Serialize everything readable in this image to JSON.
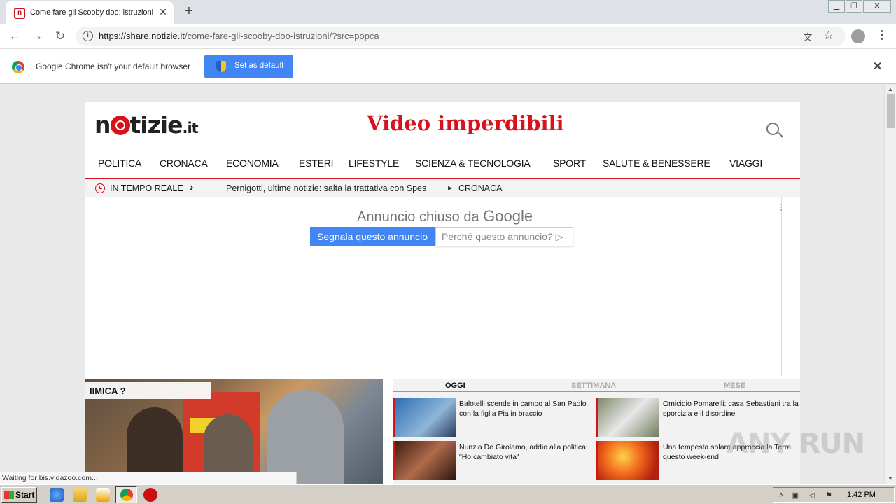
{
  "browser": {
    "tab_title": "Come fare gli Scooby doo: istruzioni",
    "favicon_letter": "n",
    "url_host": "https://share.notizie.it",
    "url_path": "/come-fare-gli-scooby-doo-istruzioni/?src=popca",
    "window_controls": [
      "minimize",
      "restore",
      "close"
    ]
  },
  "infobar": {
    "message": "Google Chrome isn't your default browser",
    "button": "Set as default"
  },
  "site": {
    "logo_text": "notizie",
    "logo_tld": ".it",
    "headline": "Video imperdibili",
    "nav": [
      "POLITICA",
      "CRONACA",
      "ECONOMIA",
      "ESTERI",
      "LIFESTYLE",
      "SCIENZA & TECNOLOGIA",
      "SPORT",
      "SALUTE & BENESSERE",
      "VIAGGI"
    ],
    "ticker": {
      "label": "IN TEMPO REALE",
      "news": "Pernigotti, ultime notizie: salta la trattativa con Spes",
      "category": "CRONACA"
    },
    "ad": {
      "closed_prefix": "Annuncio chiuso da",
      "closed_brand": "Google",
      "report_button": "Segnala questo annuncio",
      "why_button": "Perché questo annuncio? ▷"
    },
    "video_caption": "IIMICA ?",
    "mostread": {
      "tabs": [
        "OGGI",
        "SETTIMANA",
        "MESE"
      ],
      "active_tab": "OGGI",
      "articles": [
        {
          "title": "Balotelli scende in campo al San Paolo con la figlia Pia in braccio"
        },
        {
          "title": "Omicidio Pomarelli: casa Sebastiani tra la sporcizia e il disordine"
        },
        {
          "title": "Nunzia De Girolamo, addio alla politica: \"Ho cambiato vita\""
        },
        {
          "title": "Una tempesta solare approccia la Terra questo week-end"
        }
      ]
    }
  },
  "status_text": "Waiting for bis.vidazoo.com...",
  "watermark": "ANY RUN",
  "taskbar": {
    "start_label": "Start",
    "clock": "1:42 PM"
  },
  "colors": {
    "brand_red": "#d6121a",
    "chrome_blue": "#4285f4"
  }
}
